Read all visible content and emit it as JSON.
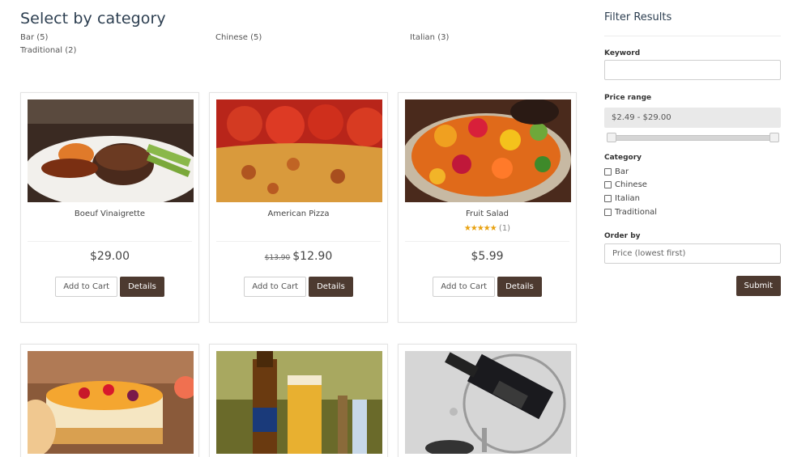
{
  "page_title": "Select by category",
  "categories": [
    {
      "label": "Bar (5)"
    },
    {
      "label": "Chinese (5)"
    },
    {
      "label": "Italian (3)"
    },
    {
      "label": "Traditional (2)"
    }
  ],
  "products": [
    {
      "name": "Boeuf Vinaigrette",
      "price": "$29.00",
      "old_price": "",
      "image": "steak-image"
    },
    {
      "name": "American Pizza",
      "price": "$12.90",
      "old_price": "$13.90",
      "image": "pizza-image"
    },
    {
      "name": "Fruit Salad",
      "price": "$5.99",
      "old_price": "",
      "rating": "★★★★★",
      "rating_count": "(1)",
      "image": "fruit-salad-image"
    },
    {
      "name": "",
      "image": "cheesecake-image"
    },
    {
      "name": "",
      "image": "beer-image"
    },
    {
      "name": "",
      "image": "wine-bottle-image"
    }
  ],
  "buttons": {
    "add_to_cart": "Add to Cart",
    "details": "Details"
  },
  "sidebar": {
    "title": "Filter Results",
    "keyword_label": "Keyword",
    "keyword_value": "",
    "price_label": "Price range",
    "price_value": "$2.49 - $29.00",
    "category_label": "Category",
    "category_options": [
      "Bar",
      "Chinese",
      "Italian",
      "Traditional"
    ],
    "order_label": "Order by",
    "order_value": "Price (lowest first)",
    "submit_label": "Submit"
  },
  "colors": {
    "accent": "#4d3a30",
    "star": "#e8a10f",
    "title": "#2c3e50"
  }
}
